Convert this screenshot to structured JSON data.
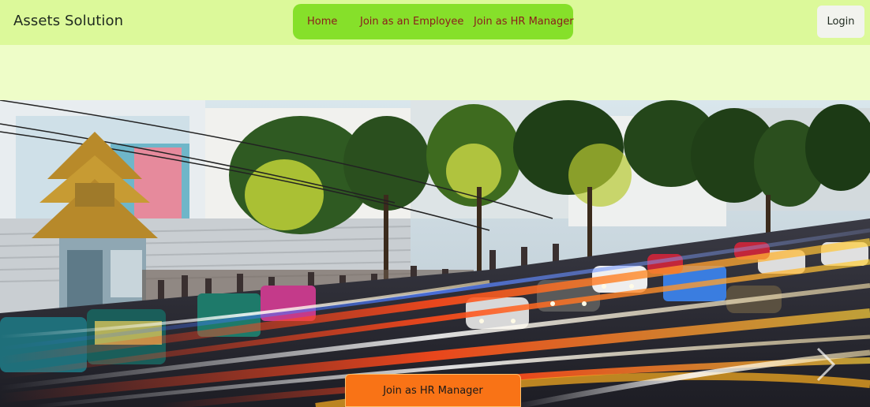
{
  "navbar": {
    "brand": "Assets Solution",
    "menu": [
      {
        "label": "Home"
      },
      {
        "label": "Join as an Employee"
      },
      {
        "label": "Join as HR Manager"
      }
    ],
    "login_label": "Login"
  },
  "hero": {
    "image": "busy city street with traffic light trails, trees and a Thai shrine",
    "cta_label": "Join as HR Manager",
    "next_icon": "chevron-right-icon"
  },
  "colors": {
    "navbar_bg": "#dcf99a",
    "page_bg": "#eefdc8",
    "menu_bg": "#86e02a",
    "menu_text": "#8b1c1c",
    "cta_bg": "#f97316"
  }
}
